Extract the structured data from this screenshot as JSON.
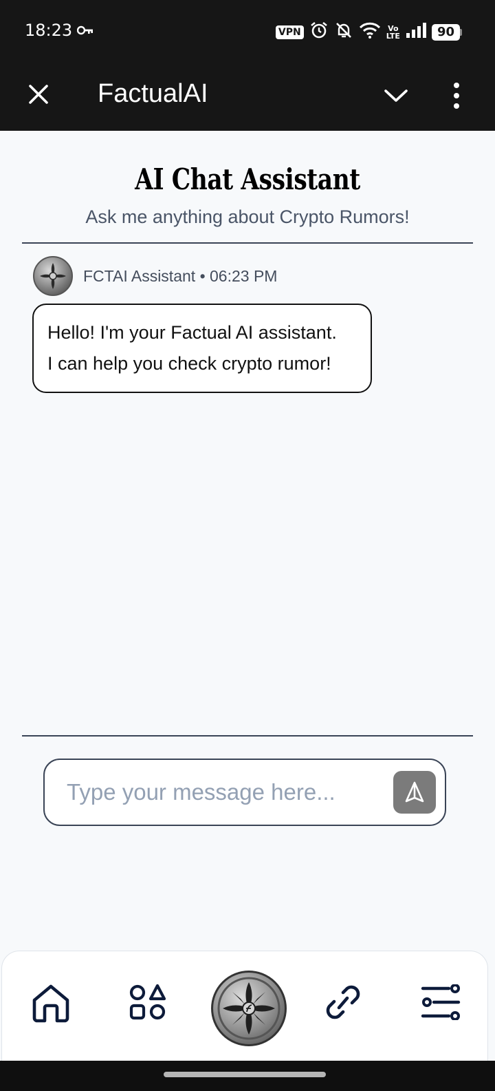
{
  "status_bar": {
    "time": "18:23",
    "vpn": "VPN",
    "lte_top": "Vo",
    "lte_bottom": "LTE",
    "battery": "90"
  },
  "app_bar": {
    "title": "FactualAI",
    "icons": [
      "close-icon",
      "chevron-down-icon",
      "more-vert-icon"
    ]
  },
  "header": {
    "title": "AI Chat Assistant",
    "subtitle": "Ask me anything about Crypto Rumors!"
  },
  "messages": [
    {
      "sender": "FCTAI Assistant",
      "separator": "•",
      "time": "06:23 PM",
      "line1": "Hello! I'm your Factual AI assistant.",
      "line2": "I can help you check crypto rumor!"
    }
  ],
  "composer": {
    "placeholder": "Type your message here...",
    "value": ""
  },
  "bottom_nav": {
    "items": [
      "home-icon",
      "apps-icon",
      "logo-emblem",
      "link-icon",
      "filters-icon"
    ]
  },
  "colors": {
    "app_bar": "#161616",
    "background": "#f7f9fb",
    "send_button": "#7b7b7b",
    "nav_icon": "#0d1b3a"
  }
}
